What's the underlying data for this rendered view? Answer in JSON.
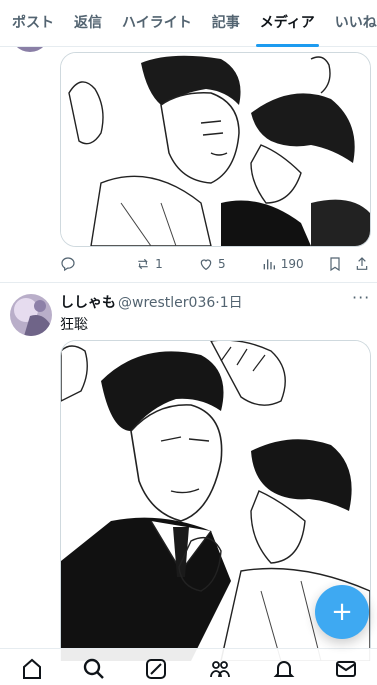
{
  "tabs": [
    {
      "label": "ポスト"
    },
    {
      "label": "返信"
    },
    {
      "label": "ハイライト"
    },
    {
      "label": "記事"
    },
    {
      "label": "メディア",
      "active": true
    },
    {
      "label": "いいね"
    }
  ],
  "post1": {
    "replies": "",
    "reposts": "1",
    "likes": "5",
    "views": "190"
  },
  "post2": {
    "display_name": "ししゃも",
    "handle": "@wrestler036",
    "time": "1日",
    "text": "狂聡"
  },
  "fab": {
    "label": "+"
  },
  "icons": [
    "reply-icon",
    "repost-icon",
    "like-icon",
    "views-icon",
    "bookmark-icon",
    "share-icon",
    "home-icon",
    "search-icon",
    "grok-icon",
    "communities-icon",
    "notifications-icon",
    "messages-icon"
  ],
  "colors": {
    "accent": "#1d9bf0",
    "text": "#0f1419",
    "muted": "#536471",
    "border": "#cfd9de"
  }
}
